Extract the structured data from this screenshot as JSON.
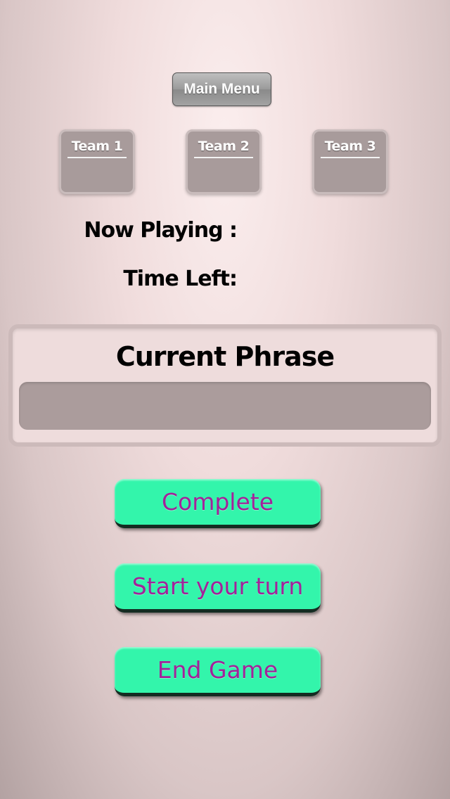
{
  "header": {
    "main_menu_label": "Main Menu"
  },
  "teams": [
    {
      "label": "Team 1"
    },
    {
      "label": "Team 2"
    },
    {
      "label": "Team 3"
    }
  ],
  "status": {
    "now_playing_label": "Now Playing :",
    "time_left_label": "Time Left:"
  },
  "phrase": {
    "title": "Current Phrase",
    "value": ""
  },
  "actions": {
    "complete_label": "Complete",
    "start_turn_label": "Start  your  turn",
    "end_game_label": "End Game"
  },
  "colors": {
    "action_button_bg": "#33f5ab",
    "action_button_text": "#a3229a",
    "team_box_bg": "#a89b9b"
  }
}
